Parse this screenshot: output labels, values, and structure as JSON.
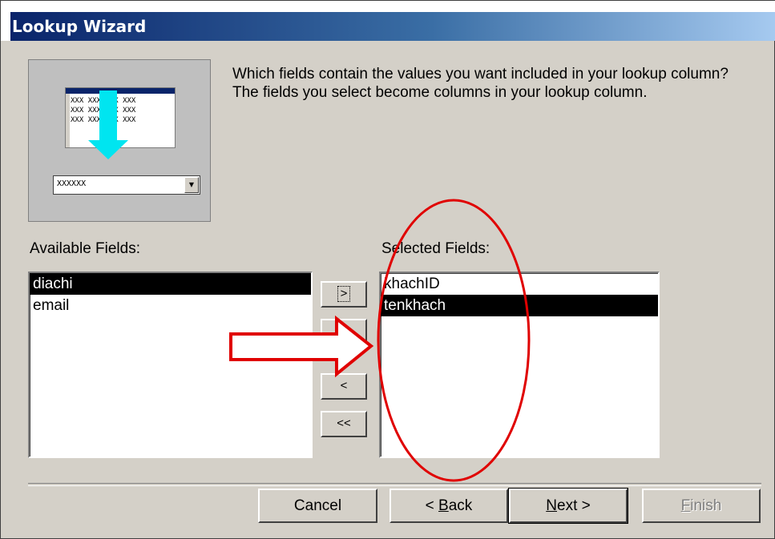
{
  "window": {
    "title": "Lookup Wizard"
  },
  "preview": {
    "grid_cell": "XXX",
    "combo_text": "XXXXXX",
    "combo_button": "▼"
  },
  "instruction": "Which fields contain the values you want included in your lookup column? The fields you select become columns in your lookup column.",
  "available": {
    "label": "Available Fields:",
    "items": [
      "diachi",
      "email"
    ],
    "selected_index": 0
  },
  "selected": {
    "label": "Selected Fields:",
    "items": [
      "khachID",
      "tenkhach"
    ],
    "selected_index": 1
  },
  "move_buttons": {
    "add_one": ">",
    "add_all": ">>",
    "remove_one": "<",
    "remove_all": "<<"
  },
  "buttons": {
    "cancel": "Cancel",
    "back_prefix": "< ",
    "back_accel": "B",
    "back_rest": "ack",
    "next_accel": "N",
    "next_rest": "ext >",
    "finish_accel": "F",
    "finish_rest": "inish"
  },
  "annotation": {
    "arrow_color": "#e00000",
    "ellipse_color": "#e00000"
  },
  "colors": {
    "title_start": "#0a246a",
    "title_end": "#a6caf0",
    "selection": "#000000",
    "face": "#d4d0c8"
  }
}
